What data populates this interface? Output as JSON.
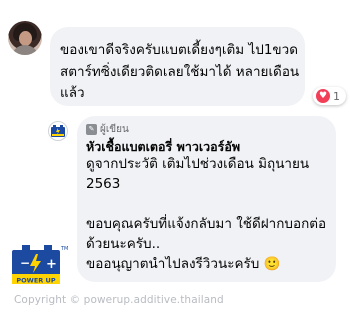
{
  "comment": {
    "text": "ของเขาดีจริงครับแบตเดี้ยงๆเติม ไป1ขวดสตาร์ทซิ่งเดียวติดเลยใช้มาได้ หลายเดือนแล้ว",
    "reaction_icon": "heart-icon",
    "reaction_count": "1",
    "reaction_color": "#f33e58"
  },
  "reply": {
    "author_badge": "ผู้เขียน",
    "author_name": "หัวเชื้อแบตเตอรี่ พาวเวอร์อัพ",
    "paragraphs": [
      "ดูจากประวัติ เติมไปช่วงเดือน มิถุนายน 2563",
      "ขอบคุณครับที่แจ้งกลับมา ใช้ดีฝากบอกต่อด้วยนะครับ..",
      "ขออนุญาตนำไปลงรีวิวนะครับ 🙂"
    ]
  },
  "logo": {
    "text": "POWER UP",
    "trademark": "TM",
    "minus": "−",
    "plus": "+"
  },
  "watermark": "Copyright © powerup.additive.thailand",
  "colors": {
    "bubble_bg": "#f0f2f5",
    "text": "#050505",
    "secondary": "#65676b",
    "logo_blue": "#1b4aa0",
    "logo_yellow": "#ffd400"
  }
}
